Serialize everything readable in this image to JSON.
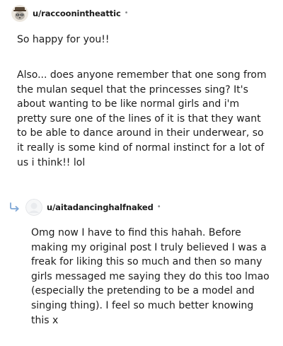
{
  "comments": [
    {
      "username": "u/raccoonintheattic",
      "separator": "•",
      "avatar_icon": "raccoon-avatar-icon",
      "paragraphs": [
        "So happy for you!!",
        "Also... does anyone remember that one song from the mulan sequel that the princesses sing? It's about wanting to be like normal girls and i'm pretty sure one of the lines of it is that they want to be able to dance around in their underwear, so it really is some kind of normal instinct for a lot of us i think!! lol"
      ]
    },
    {
      "username": "u/aitadancinghalfnaked",
      "separator": "•",
      "avatar_icon": "default-avatar-icon",
      "reply_icon": "reply-arrow-icon",
      "paragraphs": [
        "Omg now I have to find this hahah. Before making my original post I truly believed I was a freak for liking this so much and then so many girls messaged me saying they do this too lmao (especially the pretending to be a model and singing thing). I feel so much better knowing this x"
      ]
    }
  ],
  "colors": {
    "text": "#1c1c1c",
    "meta": "#878a8c",
    "reply_arrow": "#7fa7d6"
  }
}
